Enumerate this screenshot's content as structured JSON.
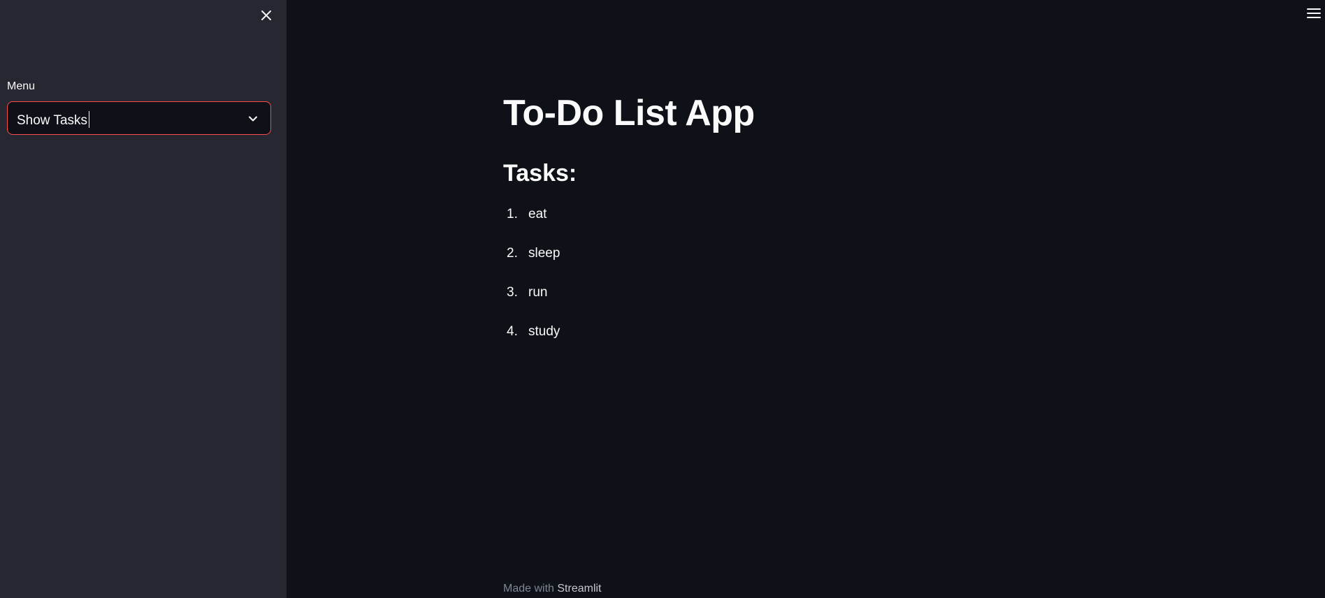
{
  "sidebar": {
    "menu_label": "Menu",
    "select_value": "Show Tasks",
    "close_icon": "close-icon",
    "chevron_icon": "chevron-down-icon"
  },
  "header": {
    "menu_icon": "hamburger-menu-icon"
  },
  "main": {
    "title": "To-Do List App",
    "subtitle": "Tasks:",
    "tasks": [
      {
        "number": "1.",
        "text": "eat"
      },
      {
        "number": "2.",
        "text": "sleep"
      },
      {
        "number": "3.",
        "text": "run"
      },
      {
        "number": "4.",
        "text": "study"
      }
    ]
  },
  "footer": {
    "prefix": "Made with ",
    "link_text": "Streamlit"
  },
  "colors": {
    "background": "#0e1117",
    "sidebar": "#262730",
    "accent": "#ff4b4b",
    "text": "#fafafa",
    "muted": "#808495"
  }
}
